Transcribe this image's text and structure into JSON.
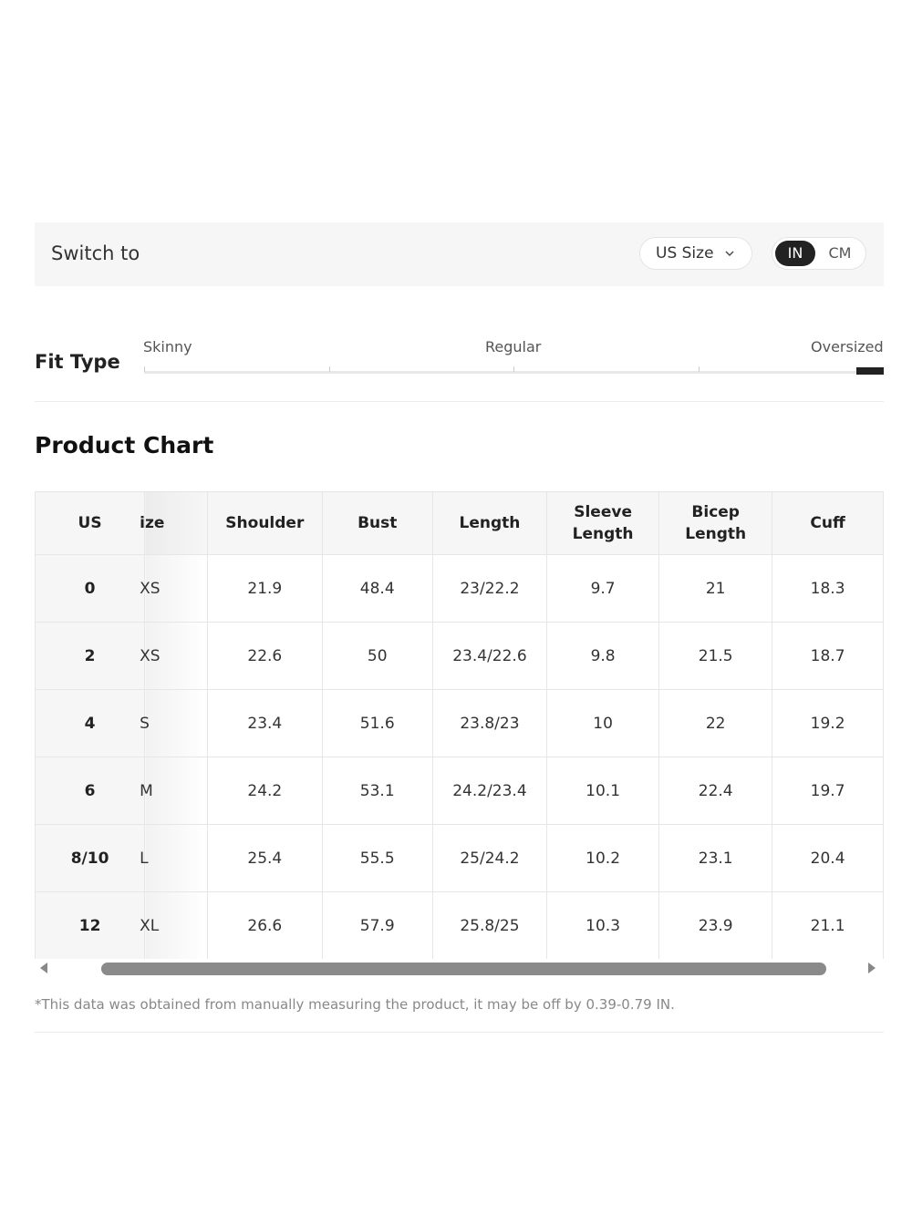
{
  "switch_bar": {
    "label": "Switch to",
    "size_select": "US Size",
    "unit_active": "IN",
    "unit_inactive": "CM"
  },
  "fit_type": {
    "title": "Fit Type",
    "labels": [
      "Skinny",
      "Regular",
      "Oversized"
    ],
    "selected": "Oversized"
  },
  "chart": {
    "title": "Product Chart",
    "headers": [
      "US",
      "ize",
      "Shoulder",
      "Bust",
      "Length",
      "Sleeve\nLength",
      "Bicep\nLength",
      "Cuff"
    ],
    "rows": [
      [
        "0",
        "XS",
        "21.9",
        "48.4",
        "23/22.2",
        "9.7",
        "21",
        "18.3"
      ],
      [
        "2",
        "XS",
        "22.6",
        "50",
        "23.4/22.6",
        "9.8",
        "21.5",
        "18.7"
      ],
      [
        "4",
        "S",
        "23.4",
        "51.6",
        "23.8/23",
        "10",
        "22",
        "19.2"
      ],
      [
        "6",
        "M",
        "24.2",
        "53.1",
        "24.2/23.4",
        "10.1",
        "22.4",
        "19.7"
      ],
      [
        "8/10",
        "L",
        "25.4",
        "55.5",
        "25/24.2",
        "10.2",
        "23.1",
        "20.4"
      ],
      [
        "12",
        "XL",
        "26.6",
        "57.9",
        "25.8/25",
        "10.3",
        "23.9",
        "21.1"
      ]
    ]
  },
  "note": "*This data was obtained from manually measuring the product, it may be off by 0.39-0.79 IN.",
  "icons": {
    "select_chevron": "chevron-down-icon",
    "scroll_left": "arrow-left-icon",
    "scroll_right": "arrow-right-icon"
  },
  "colors": {
    "toggle_active_bg": "#222222",
    "panel_bg": "#f6f6f6",
    "scroll_thumb": "#8a8a8a"
  }
}
